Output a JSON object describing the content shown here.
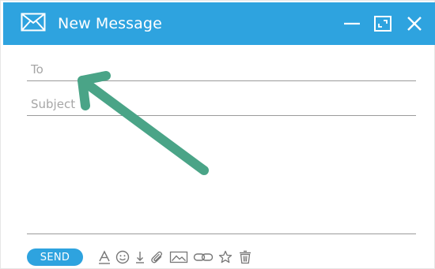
{
  "window": {
    "title": "New Message",
    "title_icon": "envelope-icon",
    "controls": [
      "minimize-icon",
      "maximize-icon",
      "close-icon"
    ],
    "accent_color": "#2ea3df"
  },
  "compose": {
    "to_placeholder": "To",
    "subject_placeholder": "Subject",
    "body_value": ""
  },
  "toolbar": {
    "send_label": "SEND",
    "tools": [
      "font-icon",
      "emoji-icon",
      "download-icon",
      "attachment-icon",
      "image-icon",
      "link-icon",
      "star-icon",
      "trash-icon"
    ]
  },
  "annotation": {
    "arrow_color": "#4aa487",
    "points_to": "To field"
  }
}
